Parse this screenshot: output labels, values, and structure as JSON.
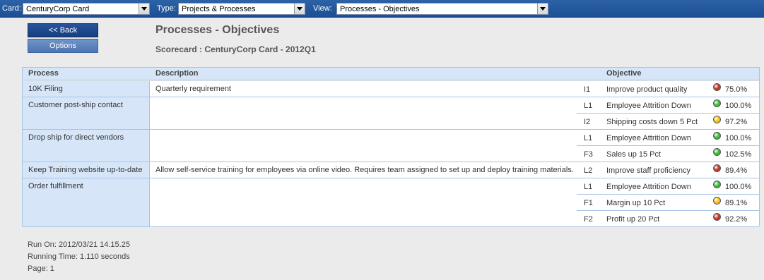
{
  "filters": {
    "card_label": "Card:",
    "card_value": "CenturyCorp Card",
    "type_label": "Type:",
    "type_value": "Projects & Processes",
    "view_label": "View:",
    "view_value": "Processes - Objectives"
  },
  "buttons": {
    "back": "<< Back",
    "options": "Options"
  },
  "page": {
    "title": "Processes - Objectives",
    "subtitle": "Scorecard : CenturyCorp Card - 2012Q1"
  },
  "table": {
    "headers": {
      "process": "Process",
      "description": "Description",
      "objective": "Objective"
    },
    "rows": [
      {
        "process": "10K Filing",
        "description": "Quarterly requirement",
        "objectives": [
          {
            "code": "I1",
            "name": "Improve product quality",
            "status": "red",
            "pct": "75.0%"
          }
        ]
      },
      {
        "process": "Customer post-ship contact",
        "description": "",
        "objectives": [
          {
            "code": "L1",
            "name": "Employee Attrition Down",
            "status": "green",
            "pct": "100.0%"
          },
          {
            "code": "I2",
            "name": "Shipping costs down 5 Pct",
            "status": "yellow",
            "pct": "97.2%"
          }
        ]
      },
      {
        "process": "Drop ship for direct vendors",
        "description": "",
        "objectives": [
          {
            "code": "L1",
            "name": "Employee Attrition Down",
            "status": "green",
            "pct": "100.0%"
          },
          {
            "code": "F3",
            "name": "Sales up 15 Pct",
            "status": "green",
            "pct": "102.5%"
          }
        ]
      },
      {
        "process": "Keep Training website up-to-date",
        "description": "Allow self-service training for employees via online video. Requires team assigned to set up and deploy training materials.",
        "objectives": [
          {
            "code": "L2",
            "name": "Improve staff proficiency",
            "status": "red",
            "pct": "89.4%"
          }
        ]
      },
      {
        "process": "Order fulfillment",
        "description": "",
        "objectives": [
          {
            "code": "L1",
            "name": "Employee Attrition Down",
            "status": "green",
            "pct": "100.0%"
          },
          {
            "code": "F1",
            "name": "Margin up 10 Pct",
            "status": "yellow",
            "pct": "89.1%"
          },
          {
            "code": "F2",
            "name": "Profit up 20 Pct",
            "status": "red",
            "pct": "92.2%"
          }
        ]
      }
    ]
  },
  "status_colors": {
    "red": "#c0392b",
    "green": "#3cb83c",
    "yellow": "#f2c21b"
  },
  "footer": {
    "run_on": "Run On: 2012/03/21 14.15.25",
    "running_time": "Running Time: 1.110 seconds",
    "page": "Page: 1"
  }
}
